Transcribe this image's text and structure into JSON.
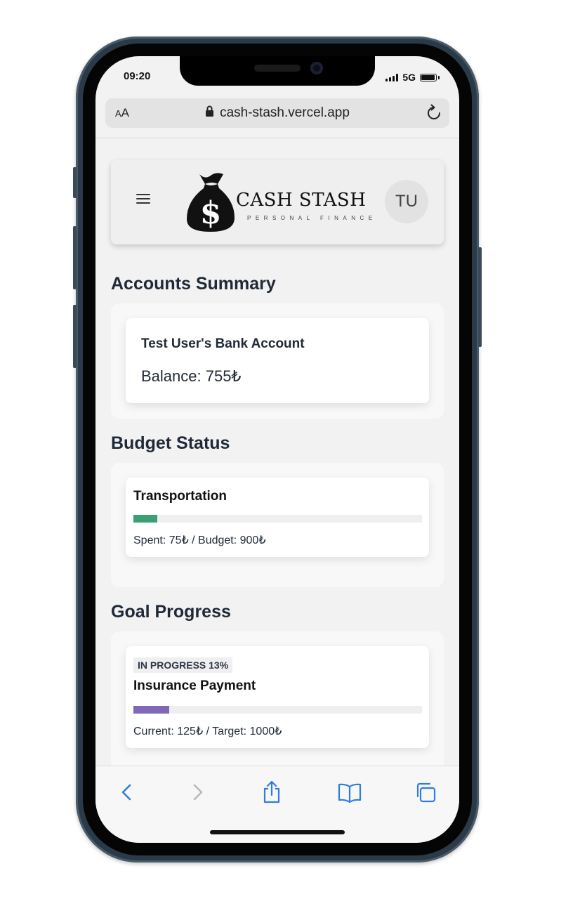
{
  "status_bar": {
    "time": "09:20",
    "network": "5G"
  },
  "browser": {
    "aa_label_small": "A",
    "aa_label_large": "A",
    "url": "cash-stash.vercel.app"
  },
  "header": {
    "logo_title": "CASH STASH",
    "logo_subtitle": "PERSONAL FINANCE",
    "avatar_initials": "TU"
  },
  "accounts": {
    "title": "Accounts Summary",
    "items": [
      {
        "name": "Test User's Bank Account",
        "balance": "Balance: 755₺"
      }
    ]
  },
  "budget": {
    "title": "Budget Status",
    "items": [
      {
        "name": "Transportation",
        "detail": "Spent: 75₺ / Budget: 900₺",
        "progress": 0.0833
      }
    ]
  },
  "goals": {
    "title": "Goal Progress",
    "items": [
      {
        "badge": "IN PROGRESS 13%",
        "name": "Insurance Payment",
        "detail": "Current: 125₺ / Target: 1000₺",
        "progress": 0.125
      }
    ]
  },
  "colors": {
    "budget_bar": "#3aa074",
    "goal_bar": "#8067b7",
    "toolbar_icons": "#2f7de1"
  },
  "toolbar": {
    "icons": [
      "back-icon",
      "forward-icon",
      "share-icon",
      "bookmarks-icon",
      "tabs-icon"
    ]
  }
}
